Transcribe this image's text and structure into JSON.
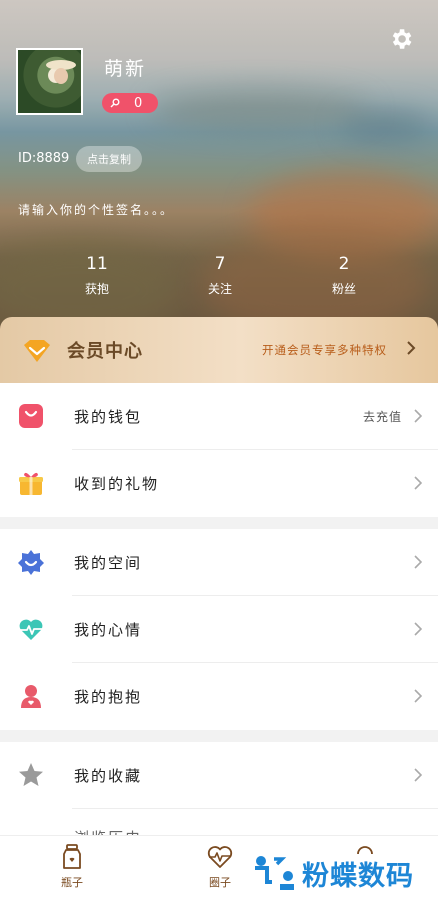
{
  "profile": {
    "username": "萌新",
    "badge_count": "0",
    "user_id": "ID:8889",
    "copy_label": "点击复制",
    "signature": "请输入你的个性签名。。。"
  },
  "stats": [
    {
      "value": "11",
      "label": "获抱"
    },
    {
      "value": "7",
      "label": "关注"
    },
    {
      "value": "2",
      "label": "粉丝"
    }
  ],
  "vip": {
    "title": "会员中心",
    "promo": "开通会员专享多种特权"
  },
  "menu": {
    "wallet": {
      "label": "我的钱包",
      "extra": "去充值"
    },
    "gifts": {
      "label": "收到的礼物"
    },
    "space": {
      "label": "我的空间"
    },
    "mood": {
      "label": "我的心情"
    },
    "hugs": {
      "label": "我的抱抱"
    },
    "favorites": {
      "label": "我的收藏"
    },
    "partial": {
      "label": "浏览历史"
    }
  },
  "nav": [
    {
      "label": "瓶子"
    },
    {
      "label": "圈子"
    }
  ],
  "watermark": {
    "text": "粉蝶数码"
  },
  "colors": {
    "accent_pink": "#f0526a",
    "vip_brown": "#6b4a27",
    "vip_orange": "#b85d1a",
    "watermark_blue": "#1d86d6"
  }
}
